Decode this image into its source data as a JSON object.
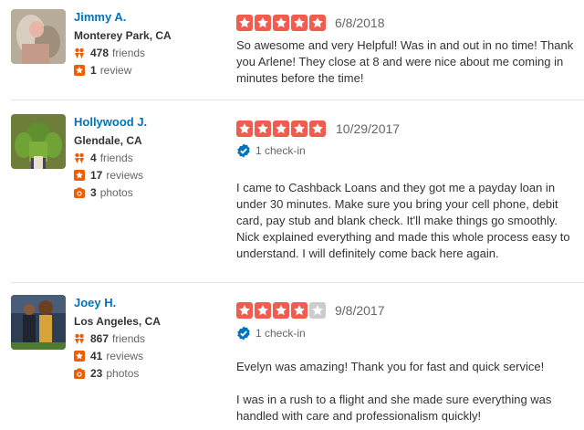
{
  "colors": {
    "star_active": "#f15c4f",
    "star_inactive": "#cccccc",
    "link_blue": "#0073bb",
    "badge_orange": "#f15c00",
    "checkin_blue": "#0073bb"
  },
  "reviews": [
    {
      "user": {
        "name": "Jimmy A.",
        "location": "Monterey Park, CA",
        "friends": "478",
        "friends_label": "friends",
        "reviews": "1",
        "reviews_label": "review"
      },
      "rating": 5,
      "date": "6/8/2018",
      "text": [
        "So awesome and very Helpful! Was in and out in no time! Thank you Arlene! They close at 8 and were nice about me coming in minutes before the time!"
      ]
    },
    {
      "user": {
        "name": "Hollywood J.",
        "location": "Glendale, CA",
        "friends": "4",
        "friends_label": "friends",
        "reviews": "17",
        "reviews_label": "reviews",
        "photos": "3",
        "photos_label": "photos"
      },
      "rating": 5,
      "date": "10/29/2017",
      "checkin": "1 check-in",
      "text": [
        "I came to Cashback Loans and they got me a payday loan in under 30 minutes. Make sure you bring your cell phone, debit card, pay stub and blank check. It'll make things go smoothly.",
        "Nick explained everything and made this whole process easy to understand. I will definitely come back here again."
      ]
    },
    {
      "user": {
        "name": "Joey H.",
        "location": "Los Angeles, CA",
        "friends": "867",
        "friends_label": "friends",
        "reviews": "41",
        "reviews_label": "reviews",
        "photos": "23",
        "photos_label": "photos"
      },
      "rating": 4,
      "date": "9/8/2017",
      "checkin": "1 check-in",
      "text": [
        "Evelyn was amazing! Thank you for fast and quick service!",
        "I was in a rush to a flight and she made sure everything was handled with care and professionalism quickly!"
      ]
    }
  ]
}
